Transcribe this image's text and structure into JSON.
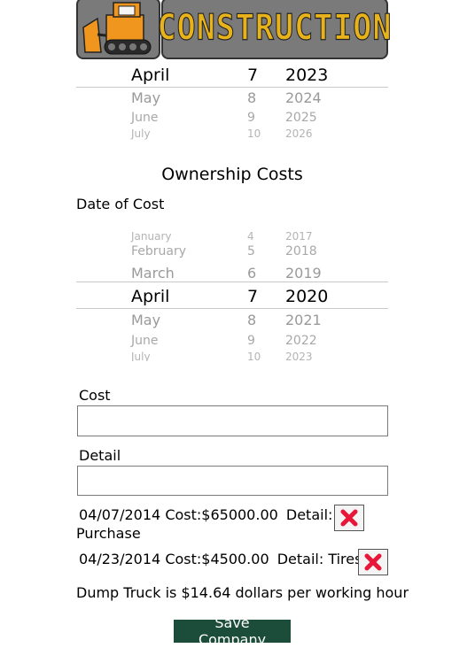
{
  "header": {
    "logo_icon": "bulldozer-icon",
    "title": "CONSTRUCTION",
    "title_color": "#e8b21a"
  },
  "top_picker": {
    "rows": [
      {
        "month": "April",
        "day": "7",
        "year": "2023",
        "state": "selected"
      },
      {
        "month": "May",
        "day": "8",
        "year": "2024",
        "state": "n1"
      },
      {
        "month": "June",
        "day": "9",
        "year": "2025",
        "state": "n2"
      },
      {
        "month": "July",
        "day": "10",
        "year": "2026",
        "state": "n3"
      }
    ]
  },
  "ownership": {
    "heading": "Ownership Costs",
    "date_label": "Date of Cost",
    "picker": {
      "rows": [
        {
          "month": "January",
          "day": "4",
          "year": "2017",
          "state": "n3"
        },
        {
          "month": "February",
          "day": "5",
          "year": "2018",
          "state": "n2"
        },
        {
          "month": "March",
          "day": "6",
          "year": "2019",
          "state": "n1"
        },
        {
          "month": "April",
          "day": "7",
          "year": "2020",
          "state": "selected"
        },
        {
          "month": "May",
          "day": "8",
          "year": "2021",
          "state": "n1"
        },
        {
          "month": "June",
          "day": "9",
          "year": "2022",
          "state": "n2"
        },
        {
          "month": "July",
          "day": "10",
          "year": "2023",
          "state": "n3"
        }
      ]
    },
    "cost_label": "Cost",
    "cost_value": "",
    "detail_label": "Detail",
    "detail_value": "",
    "entries": [
      {
        "date": "04/07/2014",
        "cost": "Cost:$65000.00",
        "detail": "Detail:",
        "detail_value": "Purchase",
        "delete_icon": "red-x-icon"
      },
      {
        "date": "04/23/2014",
        "cost": "Cost:$4500.00",
        "detail": "Detail: Tires",
        "delete_icon": "red-x-icon"
      }
    ]
  },
  "summary": "Dump Truck is $14.64 dollars per working hour",
  "save_button": "Save Company",
  "colors": {
    "save_bg": "#1c4d3a",
    "delete_x": "#e8173a",
    "banner": "#7a7a7a"
  }
}
